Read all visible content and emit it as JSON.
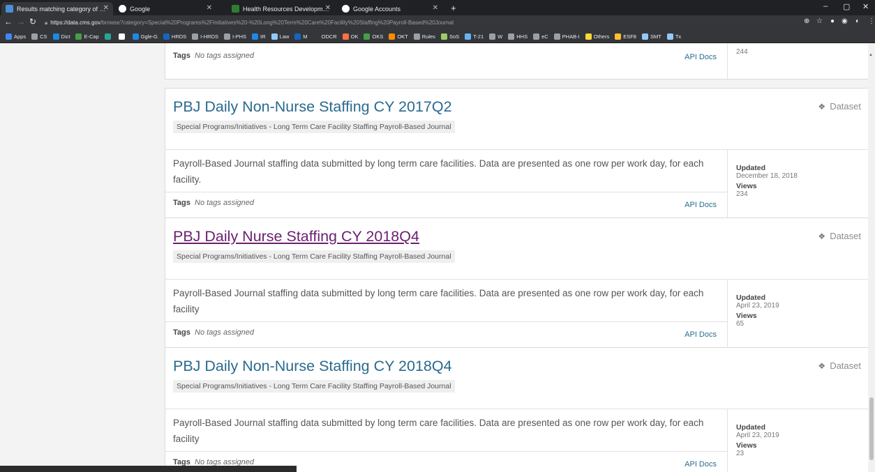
{
  "browser": {
    "tabs": [
      {
        "label": "Results matching category of Sp...",
        "color": "#4a90d9"
      },
      {
        "label": "Google",
        "color": "#ffffff"
      },
      {
        "label": "",
        "color": "#35363a"
      },
      {
        "label": "Health Resources Development",
        "color": "#2e7d32"
      },
      {
        "label": "Google Accounts",
        "color": "#ffffff"
      }
    ],
    "url_host": "https://data.cms.gov",
    "url_path": "/browse?category=Special%20Programs%2FInitiatives%20-%20Long%20Term%20Care%20Facility%20Staffing%20Payroll-Based%20Journal",
    "bookmarks": [
      {
        "label": "Apps",
        "color": "#4285f4"
      },
      {
        "label": "CS",
        "color": "#9aa0a6"
      },
      {
        "label": "Dict",
        "color": "#1e88e5"
      },
      {
        "label": "E-Cap",
        "color": "#43a047"
      },
      {
        "label": "",
        "color": "#26a69a"
      },
      {
        "label": "",
        "color": "#ffffff"
      },
      {
        "label": "Ggle-G",
        "color": "#1e88e5"
      },
      {
        "label": "HRDS",
        "color": "#1565c0"
      },
      {
        "label": "I-HRDS",
        "color": "#9aa0a6"
      },
      {
        "label": "I-PHS",
        "color": "#9aa0a6"
      },
      {
        "label": "IR",
        "color": "#1e88e5"
      },
      {
        "label": "Law",
        "color": "#90caf9"
      },
      {
        "label": "M",
        "color": "#1565c0"
      },
      {
        "label": "ODCR",
        "color": "#35363a"
      },
      {
        "label": "OK",
        "color": "#ff7043"
      },
      {
        "label": "OKS",
        "color": "#43a047"
      },
      {
        "label": "OKT",
        "color": "#fb8c00"
      },
      {
        "label": "Rules",
        "color": "#9aa0a6"
      },
      {
        "label": "SoS",
        "color": "#9ccc65"
      },
      {
        "label": "T-21",
        "color": "#64b5f6"
      },
      {
        "label": "W",
        "color": "#9aa0a6"
      },
      {
        "label": "HHS",
        "color": "#9aa0a6"
      },
      {
        "label": "eC",
        "color": "#9aa0a6"
      },
      {
        "label": "PHAB-I",
        "color": "#9aa0a6"
      },
      {
        "label": "Others",
        "color": "#fdd835"
      },
      {
        "label": "ESF8",
        "color": "#fbc02d"
      },
      {
        "label": "SMT",
        "color": "#90caf9"
      },
      {
        "label": "Tx",
        "color": "#90caf9"
      }
    ]
  },
  "partial_card": {
    "tags_label": "Tags",
    "tags_value": "No tags assigned",
    "api_docs": "API Docs",
    "views_value": "244"
  },
  "cards": [
    {
      "title": "PBJ Daily Non-Nurse Staffing CY 2017Q2",
      "type_label": "Dataset",
      "category": "Special Programs/Initiatives - Long Term Care Facility Staffing Payroll-Based Journal",
      "description": "Payroll-Based Journal staffing data submitted by long term care facilities. Data are presented as one row per work day, for each facility.",
      "tags_label": "Tags",
      "tags_value": "No tags assigned",
      "api_docs": "API Docs",
      "updated_label": "Updated",
      "updated_value": "December 18, 2018",
      "views_label": "Views",
      "views_value": "234"
    },
    {
      "title": "PBJ Daily Nurse Staffing CY 2018Q4",
      "type_label": "Dataset",
      "category": "Special Programs/Initiatives - Long Term Care Facility Staffing Payroll-Based Journal",
      "description": "Payroll-Based Journal staffing data submitted by long term care facilities. Data are presented as one row per work day, for each facility",
      "tags_label": "Tags",
      "tags_value": "No tags assigned",
      "api_docs": "API Docs",
      "updated_label": "Updated",
      "updated_value": "April 23, 2019",
      "views_label": "Views",
      "views_value": "65"
    },
    {
      "title": "PBJ Daily Non-Nurse Staffing CY 2018Q4",
      "type_label": "Dataset",
      "category": "Special Programs/Initiatives - Long Term Care Facility Staffing Payroll-Based Journal",
      "description": "Payroll-Based Journal staffing data submitted by long term care facilities. Data are presented as one row per work day, for each facility",
      "tags_label": "Tags",
      "tags_value": "No tags assigned",
      "api_docs": "API Docs",
      "updated_label": "Updated",
      "updated_value": "April 23, 2019",
      "views_label": "Views",
      "views_value": "23"
    }
  ],
  "colors": {
    "title_link": "#2a6a8e",
    "title_visited": "#6b2070"
  }
}
